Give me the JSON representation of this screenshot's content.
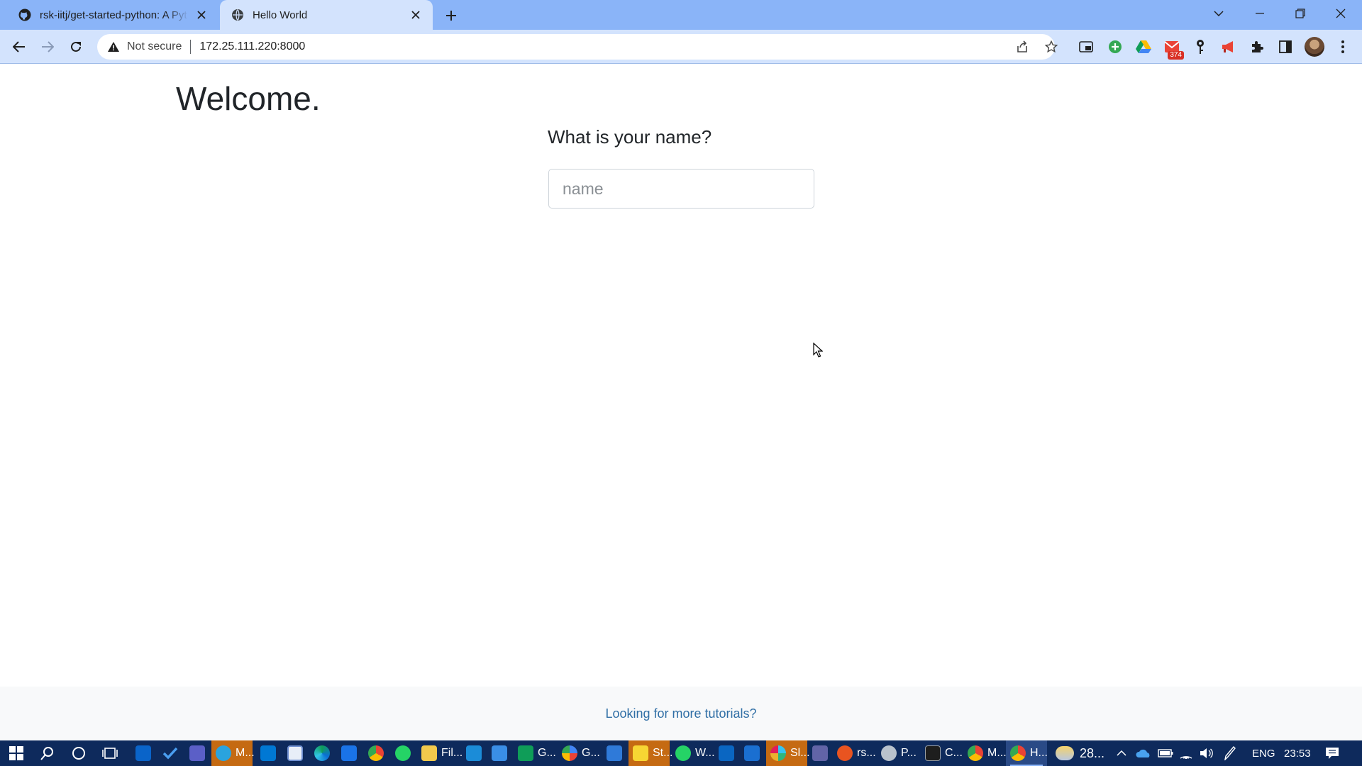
{
  "browser": {
    "tabs": [
      {
        "title": "rsk-iitj/get-started-python: A Pyt",
        "icon": "github-icon",
        "active": false
      },
      {
        "title": "Hello World",
        "icon": "globe-icon",
        "active": true
      }
    ],
    "address_bar": {
      "security_text": "Not secure",
      "url": "172.25.111.220:8000"
    },
    "extensions": {
      "gmail_badge": "374"
    }
  },
  "page": {
    "heading": "Welcome.",
    "question": "What is your name?",
    "name_input": {
      "placeholder": "name",
      "value": ""
    },
    "footer_link": "Looking for more tutorials?"
  },
  "taskbar": {
    "apps": [
      {
        "name": "telegram-app",
        "label": "M..."
      },
      {
        "name": "file-explorer-app",
        "label": "Fil..."
      },
      {
        "name": "sheets-app",
        "label": "G..."
      },
      {
        "name": "google-app",
        "label": "G..."
      },
      {
        "name": "sticky-notes-app",
        "label": "St..."
      },
      {
        "name": "whatsapp-app",
        "label": "W..."
      },
      {
        "name": "slack-app",
        "label": "Sl..."
      },
      {
        "name": "ubuntu-app",
        "label": "rs..."
      },
      {
        "name": "postman-app",
        "label": "P..."
      },
      {
        "name": "terminal-app",
        "label": "C..."
      },
      {
        "name": "chrome-app-m",
        "label": "M..."
      },
      {
        "name": "chrome-app-h",
        "label": "H..."
      }
    ],
    "weather": "28...",
    "language": "ENG",
    "time": "23:53"
  },
  "colors": {
    "tabstrip": "#8ab4f8",
    "toolbar": "#d3e3fd",
    "link": "#2f6ea5",
    "taskbar": "#0e2a5c"
  }
}
